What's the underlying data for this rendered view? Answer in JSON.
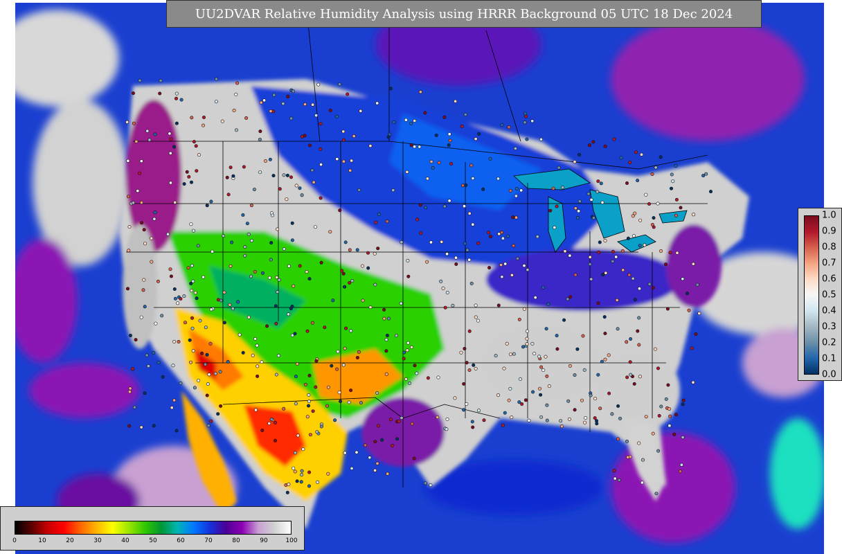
{
  "title": "UU2DVAR Relative Humidity Analysis using HRRR Background 05 UTC 18 Dec 2024",
  "colorbar_rh": {
    "ticks": [
      "0",
      "10",
      "20",
      "30",
      "40",
      "50",
      "60",
      "70",
      "80",
      "90",
      "100"
    ],
    "stops": [
      "#000000",
      "#5a0000",
      "#c80000",
      "#ff0000",
      "#ff6400",
      "#ffb400",
      "#ffff00",
      "#9be600",
      "#32c800",
      "#009632",
      "#00b4b4",
      "#0078ff",
      "#1432dc",
      "#4b0096",
      "#8c00b4",
      "#c8a0d2",
      "#d2d2d2",
      "#ffffff"
    ]
  },
  "colorbar_obs": {
    "ticks": [
      "1.0",
      "0.9",
      "0.8",
      "0.7",
      "0.6",
      "0.5",
      "0.4",
      "0.3",
      "0.2",
      "0.1",
      "0.0"
    ],
    "stops": [
      "#7a0c1f",
      "#b2182b",
      "#d6604d",
      "#f4a582",
      "#fddbc7",
      "#f7f7f7",
      "#d1e5f0",
      "#a3b8c2",
      "#6c8fa8",
      "#2166ac",
      "#053061"
    ]
  },
  "colors": {
    "ocean": "#1a3fd0",
    "land_dry": "#d0d0d0",
    "moist_purple": "#7a1aa8",
    "desert_red": "#ff2a00",
    "desert_yellow": "#ffd200",
    "green": "#22c800",
    "border": "#000000"
  }
}
